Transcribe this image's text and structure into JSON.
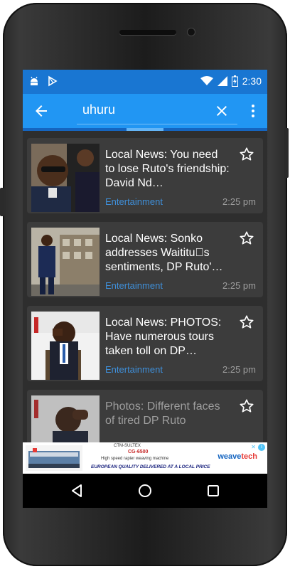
{
  "status": {
    "time": "2:30",
    "left_icons": [
      "android-debug-icon",
      "play-store-icon"
    ],
    "right_icons": [
      "wifi-icon",
      "signal-icon",
      "battery-icon"
    ]
  },
  "appbar": {
    "search_query": "uhuru",
    "back_icon": "arrow-back-icon",
    "clear_icon": "close-icon",
    "menu_icon": "more-vert-icon"
  },
  "articles": [
    {
      "title": "Local News: You need to lose Ruto's friendship: David Nd…",
      "category": "Entertainment",
      "time": "2:25 pm"
    },
    {
      "title": "Local News: Sonko addresses Waititu\u0000s sentiments, DP Ruto'…",
      "category": "Entertainment",
      "time": "2:25 pm"
    },
    {
      "title": "Local News: PHOTOS: Have numerous tours taken toll on DP…",
      "category": "Entertainment",
      "time": "2:25 pm"
    },
    {
      "title": "Photos: Different faces of tired DP Ruto",
      "category": "",
      "time": ""
    }
  ],
  "ad": {
    "line1": "CTM-SULTEX",
    "line2": "CG-6500",
    "line3": "High speed rapier weaving machine",
    "line4": "EUROPEAN QUALITY DELIVERED AT A LOCAL PRICE",
    "brand_main": "weave",
    "brand_accent": "tech"
  },
  "colors": {
    "status_bar": "#1976d2",
    "app_bar": "#2196f3",
    "card_bg": "#3c3c3c",
    "screen_bg": "#2e2e2e",
    "category_text": "#3f8fd9"
  }
}
